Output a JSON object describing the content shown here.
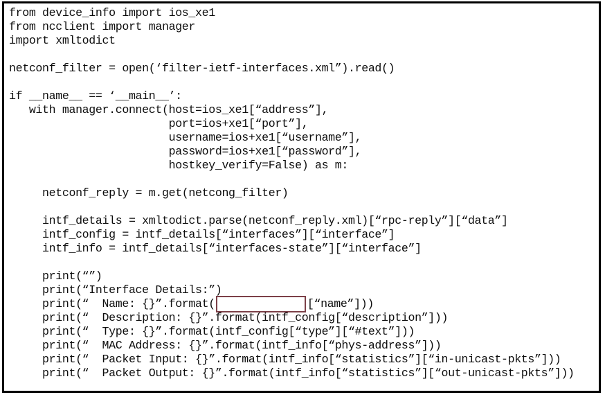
{
  "window": {
    "name": "python-code-listing",
    "border_color": "#000000",
    "background_color": "#ffffff"
  },
  "code": {
    "language": "python",
    "lines": [
      {
        "text": "from device_info import ios_xe1"
      },
      {
        "text": "from ncclient import manager"
      },
      {
        "text": "import xmltodict"
      },
      {
        "text": ""
      },
      {
        "text": "netconf_filter = open(‘filter-ietf-interfaces.xml”).read()"
      },
      {
        "text": ""
      },
      {
        "text": "if __name__ == ‘__main__’:"
      },
      {
        "text": "   with manager.connect(host=ios_xe1[“address”],"
      },
      {
        "text": "                        port=ios+xe1[“port”],"
      },
      {
        "text": "                        username=ios+xe1[“username”],"
      },
      {
        "text": "                        password=ios+xe1[“password”],"
      },
      {
        "text": "                        hostkey_verify=False) as m:"
      },
      {
        "text": ""
      },
      {
        "text": "     netconf_reply = m.get(netcong_filter)"
      },
      {
        "text": ""
      },
      {
        "text": "     intf_details = xmltodict.parse(netconf_reply.xml)[“rpc-reply”][“data”]"
      },
      {
        "text": "     intf_config = intf_details[“interfaces”][“interface”]"
      },
      {
        "text": "     intf_info = intf_details[“interfaces-state”][“interface”]"
      },
      {
        "text": ""
      },
      {
        "text": "     print(“”)"
      },
      {
        "text": "     print(“Interface Details:”)"
      },
      {
        "text": "     print(“  Name: {}”.format(",
        "slot": true,
        "text_after": "[“name”]))"
      },
      {
        "text": "     print(“  Description: {}”.format(intf_config[“description”]))"
      },
      {
        "text": "     print(“  Type: {}”.format(intf_config[“type”][“#text”]))"
      },
      {
        "text": "     print(“  MAC Address: {}”.format(intf_info[“phys-address”]))"
      },
      {
        "text": "     print(“  Packet Input: {}”.format(intf_info[“statistics”][“in-unicast-pkts”]))"
      },
      {
        "text": "     print(“  Packet Output: {}”.format(intf_info[“statistics”][“out-unicast-pkts”]))"
      }
    ]
  },
  "answer_slot": {
    "name": "code-blank-answer-input",
    "value": "",
    "placeholder": "",
    "border_color": "#7c4048",
    "background_color": "#ffffff"
  }
}
